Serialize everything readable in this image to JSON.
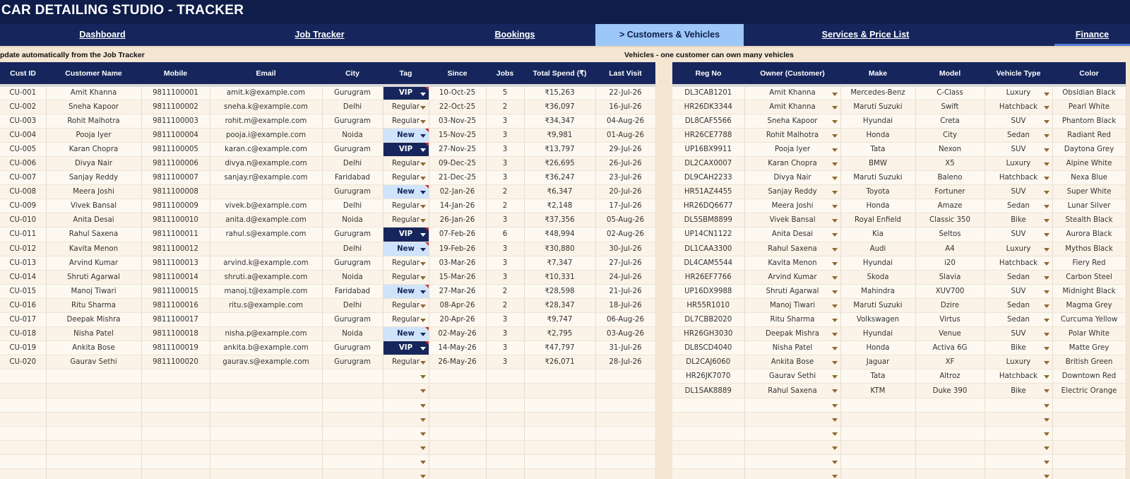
{
  "app": {
    "title": "CAR DETAILING STUDIO - TRACKER"
  },
  "nav": {
    "tabs": [
      {
        "label": "Dashboard"
      },
      {
        "label": "Job Tracker"
      },
      {
        "label": "Bookings"
      },
      {
        "label": "> Customers & Vehicles"
      },
      {
        "label": "Services & Price List"
      },
      {
        "label": "Finance"
      }
    ],
    "active": 3
  },
  "customers": {
    "note": "pdate automatically from the Job Tracker",
    "headers": [
      "Cust ID",
      "Customer Name",
      "Mobile",
      "Email",
      "City",
      "Tag",
      "Since",
      "Jobs",
      "Total Spend (₹)",
      "Last Visit"
    ],
    "rows": [
      [
        "CU-001",
        "Amit Khanna",
        "9811100001",
        "amit.k@example.com",
        "Gurugram",
        "VIP",
        "10-Oct-25",
        "5",
        "₹15,263",
        "22-Jul-26"
      ],
      [
        "CU-002",
        "Sneha Kapoor",
        "9811100002",
        "sneha.k@example.com",
        "Delhi",
        "Regular",
        "22-Oct-25",
        "2",
        "₹36,097",
        "16-Jul-26"
      ],
      [
        "CU-003",
        "Rohit Malhotra",
        "9811100003",
        "rohit.m@example.com",
        "Gurugram",
        "Regular",
        "03-Nov-25",
        "3",
        "₹34,347",
        "04-Aug-26"
      ],
      [
        "CU-004",
        "Pooja Iyer",
        "9811100004",
        "pooja.i@example.com",
        "Noida",
        "New",
        "15-Nov-25",
        "3",
        "₹9,981",
        "01-Aug-26"
      ],
      [
        "CU-005",
        "Karan Chopra",
        "9811100005",
        "karan.c@example.com",
        "Gurugram",
        "VIP",
        "27-Nov-25",
        "3",
        "₹13,797",
        "29-Jul-26"
      ],
      [
        "CU-006",
        "Divya Nair",
        "9811100006",
        "divya.n@example.com",
        "Delhi",
        "Regular",
        "09-Dec-25",
        "3",
        "₹26,695",
        "26-Jul-26"
      ],
      [
        "CU-007",
        "Sanjay Reddy",
        "9811100007",
        "sanjay.r@example.com",
        "Faridabad",
        "Regular",
        "21-Dec-25",
        "3",
        "₹36,247",
        "23-Jul-26"
      ],
      [
        "CU-008",
        "Meera Joshi",
        "9811100008",
        "",
        "Gurugram",
        "New",
        "02-Jan-26",
        "2",
        "₹6,347",
        "20-Jul-26"
      ],
      [
        "CU-009",
        "Vivek Bansal",
        "9811100009",
        "vivek.b@example.com",
        "Delhi",
        "Regular",
        "14-Jan-26",
        "2",
        "₹2,148",
        "17-Jul-26"
      ],
      [
        "CU-010",
        "Anita Desai",
        "9811100010",
        "anita.d@example.com",
        "Noida",
        "Regular",
        "26-Jan-26",
        "3",
        "₹37,356",
        "05-Aug-26"
      ],
      [
        "CU-011",
        "Rahul Saxena",
        "9811100011",
        "rahul.s@example.com",
        "Gurugram",
        "VIP",
        "07-Feb-26",
        "6",
        "₹48,994",
        "02-Aug-26"
      ],
      [
        "CU-012",
        "Kavita Menon",
        "9811100012",
        "",
        "Delhi",
        "New",
        "19-Feb-26",
        "3",
        "₹30,880",
        "30-Jul-26"
      ],
      [
        "CU-013",
        "Arvind Kumar",
        "9811100013",
        "arvind.k@example.com",
        "Gurugram",
        "Regular",
        "03-Mar-26",
        "3",
        "₹7,347",
        "27-Jul-26"
      ],
      [
        "CU-014",
        "Shruti Agarwal",
        "9811100014",
        "shruti.a@example.com",
        "Noida",
        "Regular",
        "15-Mar-26",
        "3",
        "₹10,331",
        "24-Jul-26"
      ],
      [
        "CU-015",
        "Manoj Tiwari",
        "9811100015",
        "manoj.t@example.com",
        "Faridabad",
        "New",
        "27-Mar-26",
        "2",
        "₹28,598",
        "21-Jul-26"
      ],
      [
        "CU-016",
        "Ritu Sharma",
        "9811100016",
        "ritu.s@example.com",
        "Delhi",
        "Regular",
        "08-Apr-26",
        "2",
        "₹28,347",
        "18-Jul-26"
      ],
      [
        "CU-017",
        "Deepak Mishra",
        "9811100017",
        "",
        "Gurugram",
        "Regular",
        "20-Apr-26",
        "3",
        "₹9,747",
        "06-Aug-26"
      ],
      [
        "CU-018",
        "Nisha Patel",
        "9811100018",
        "nisha.p@example.com",
        "Noida",
        "New",
        "02-May-26",
        "3",
        "₹2,795",
        "03-Aug-26"
      ],
      [
        "CU-019",
        "Ankita Bose",
        "9811100019",
        "ankita.b@example.com",
        "Gurugram",
        "VIP",
        "14-May-26",
        "3",
        "₹47,797",
        "31-Jul-26"
      ],
      [
        "CU-020",
        "Gaurav Sethi",
        "9811100020",
        "gaurav.s@example.com",
        "Gurugram",
        "Regular",
        "26-May-26",
        "3",
        "₹26,071",
        "28-Jul-26"
      ]
    ]
  },
  "vehicles": {
    "note": "Vehicles - one customer can own many vehicles",
    "headers": [
      "Reg No",
      "Owner (Customer)",
      "Make",
      "Model",
      "Vehicle Type",
      "Color"
    ],
    "rows": [
      [
        "DL3CAB1201",
        "Amit Khanna",
        "Mercedes-Benz",
        "C-Class",
        "Luxury",
        "Obsidian Black"
      ],
      [
        "HR26DK3344",
        "Amit Khanna",
        "Maruti Suzuki",
        "Swift",
        "Hatchback",
        "Pearl White"
      ],
      [
        "DL8CAF5566",
        "Sneha Kapoor",
        "Hyundai",
        "Creta",
        "SUV",
        "Phantom Black"
      ],
      [
        "HR26CE7788",
        "Rohit Malhotra",
        "Honda",
        "City",
        "Sedan",
        "Radiant Red"
      ],
      [
        "UP16BX9911",
        "Pooja Iyer",
        "Tata",
        "Nexon",
        "SUV",
        "Daytona Grey"
      ],
      [
        "DL2CAX0007",
        "Karan Chopra",
        "BMW",
        "X5",
        "Luxury",
        "Alpine White"
      ],
      [
        "DL9CAH2233",
        "Divya Nair",
        "Maruti Suzuki",
        "Baleno",
        "Hatchback",
        "Nexa Blue"
      ],
      [
        "HR51AZ4455",
        "Sanjay Reddy",
        "Toyota",
        "Fortuner",
        "SUV",
        "Super White"
      ],
      [
        "HR26DQ6677",
        "Meera Joshi",
        "Honda",
        "Amaze",
        "Sedan",
        "Lunar Silver"
      ],
      [
        "DL5SBM8899",
        "Vivek Bansal",
        "Royal Enfield",
        "Classic 350",
        "Bike",
        "Stealth Black"
      ],
      [
        "UP14CN1122",
        "Anita Desai",
        "Kia",
        "Seltos",
        "SUV",
        "Aurora Black"
      ],
      [
        "DL1CAA3300",
        "Rahul Saxena",
        "Audi",
        "A4",
        "Luxury",
        "Mythos Black"
      ],
      [
        "DL4CAM5544",
        "Kavita Menon",
        "Hyundai",
        "i20",
        "Hatchback",
        "Fiery Red"
      ],
      [
        "HR26EF7766",
        "Arvind Kumar",
        "Skoda",
        "Slavia",
        "Sedan",
        "Carbon Steel"
      ],
      [
        "UP16DX9988",
        "Shruti Agarwal",
        "Mahindra",
        "XUV700",
        "SUV",
        "Midnight Black"
      ],
      [
        "HR55R1010",
        "Manoj Tiwari",
        "Maruti Suzuki",
        "Dzire",
        "Sedan",
        "Magma Grey"
      ],
      [
        "DL7CBB2020",
        "Ritu Sharma",
        "Volkswagen",
        "Virtus",
        "Sedan",
        "Curcuma Yellow"
      ],
      [
        "HR26GH3030",
        "Deepak Mishra",
        "Hyundai",
        "Venue",
        "SUV",
        "Polar White"
      ],
      [
        "DL8SCD4040",
        "Nisha Patel",
        "Honda",
        "Activa 6G",
        "Bike",
        "Matte Grey"
      ],
      [
        "DL2CAJ6060",
        "Ankita Bose",
        "Jaguar",
        "XF",
        "Luxury",
        "British Green"
      ],
      [
        "HR26JK7070",
        "Gaurav Sethi",
        "Tata",
        "Altroz",
        "Hatchback",
        "Downtown Red"
      ],
      [
        "DL1SAK8889",
        "Rahul Saxena",
        "KTM",
        "Duke 390",
        "Bike",
        "Electric Orange"
      ]
    ]
  },
  "empty_rows": {
    "customers": 8,
    "vehicles": 6
  },
  "colors": {
    "title_bg": "#0f1d4a",
    "header_bg": "#16265c",
    "active_tab": "#9cc7f7",
    "vip_bg": "#16265c",
    "new_bg": "#cfe4fb",
    "page_bg": "#f5e6d3"
  }
}
